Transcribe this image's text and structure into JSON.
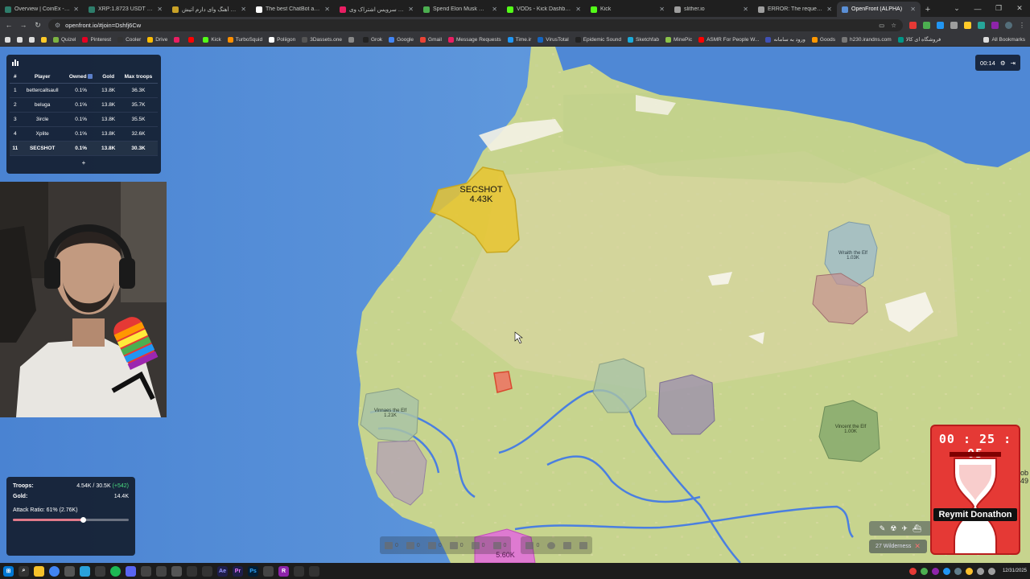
{
  "browser": {
    "tabs": [
      {
        "title": "Overview | CoinEx - The G",
        "color": "#2e7d6b",
        "active": false
      },
      {
        "title": "XRP:1.8723 USDT | Futur",
        "color": "#2e7d6b",
        "active": false
      },
      {
        "title": "دانلود آهنگ وای دارم آتیش",
        "color": "#c9a227",
        "active": false
      },
      {
        "title": "The best ChatBot and Wr",
        "color": "#ffffff",
        "active": false
      },
      {
        "title": "آپارات - سرویس اشتراک وی",
        "color": "#e91e63",
        "active": false
      },
      {
        "title": "Spend Elon Musk Money",
        "color": "#4caf50",
        "active": false
      },
      {
        "title": "VODs - Kick Dashboard",
        "color": "#53fc18",
        "active": false
      },
      {
        "title": "Kick",
        "color": "#53fc18",
        "active": false
      },
      {
        "title": "slither.io",
        "color": "#9e9e9e",
        "active": false
      },
      {
        "title": "ERROR: The request coul",
        "color": "#9e9e9e",
        "active": false
      },
      {
        "title": "OpenFront (ALPHA)",
        "color": "#5a8fd6",
        "active": true
      }
    ],
    "url": "openfront.io/#join=Dshfj6Cw",
    "bookmarks": [
      {
        "label": "Quizel",
        "color": "#7cb342"
      },
      {
        "label": "Pinterest",
        "color": "#e60023"
      },
      {
        "label": "Cooler",
        "color": "#333333"
      },
      {
        "label": "Drive",
        "color": "#fbbc04"
      },
      {
        "label": "",
        "color": "#e91e63"
      },
      {
        "label": "",
        "color": "#ff0000"
      },
      {
        "label": "Kick",
        "color": "#53fc18"
      },
      {
        "label": "TurboSquid",
        "color": "#ff8f00"
      },
      {
        "label": "Poliigon",
        "color": "#ffffff"
      },
      {
        "label": "3Dassets.one",
        "color": "#555555"
      },
      {
        "label": "",
        "color": "#888888"
      },
      {
        "label": "Grok",
        "color": "#222222"
      },
      {
        "label": "Google",
        "color": "#4285f4"
      },
      {
        "label": "Gmail",
        "color": "#ea4335"
      },
      {
        "label": "Message Requests",
        "color": "#e91e63"
      },
      {
        "label": "Time.ir",
        "color": "#2196f3"
      },
      {
        "label": "VirusTotal",
        "color": "#1565c0"
      },
      {
        "label": "Epidemic Sound",
        "color": "#222222"
      },
      {
        "label": "Sketchfab",
        "color": "#1caad9"
      },
      {
        "label": "MinePic",
        "color": "#8bc34a"
      },
      {
        "label": "ASMR For People W...",
        "color": "#ff0000"
      },
      {
        "label": "ورود به سامانه",
        "color": "#3f51b5"
      },
      {
        "label": "Goods",
        "color": "#ff9800"
      },
      {
        "label": "h230.irandns.com",
        "color": "#777777"
      },
      {
        "label": "فروشگاه ای کالا",
        "color": "#009688"
      }
    ],
    "all_bookmarks": "All Bookmarks"
  },
  "leaderboard": {
    "columns": [
      "#",
      "Player",
      "Owned",
      "Gold",
      "Max troops"
    ],
    "rows": [
      {
        "rank": "1",
        "player": "bettercallsaull",
        "owned": "0.1%",
        "gold": "13.8K",
        "troops": "36.3K"
      },
      {
        "rank": "2",
        "player": "beluga",
        "owned": "0.1%",
        "gold": "13.8K",
        "troops": "35.7K"
      },
      {
        "rank": "3",
        "player": "3ircle",
        "owned": "0.1%",
        "gold": "13.8K",
        "troops": "35.5K"
      },
      {
        "rank": "4",
        "player": "Xplite",
        "owned": "0.1%",
        "gold": "13.8K",
        "troops": "32.6K"
      },
      {
        "rank": "11",
        "player": "SECSHOT",
        "owned": "0.1%",
        "gold": "13.8K",
        "troops": "30.3K"
      }
    ],
    "more": "+"
  },
  "territories": {
    "secshot": {
      "name": "SECSHOT",
      "troops": "4.43K",
      "color": "#e8c430"
    },
    "wraith": {
      "name": "Wraith the Elf",
      "troops": "1.03K",
      "color": "#9fbcc8"
    },
    "vinnaes": {
      "name": "Vinnaes the Elf",
      "troops": "1.21K",
      "color": "#a9c3a6"
    },
    "vincent": {
      "name": "Vincent the Elf",
      "troops": "1.00K",
      "color": "#86a96d"
    },
    "bottom": {
      "name": "",
      "troops": "5.60K",
      "color": "#e070d8"
    }
  },
  "stats": {
    "troops_label": "Troops:",
    "troops_value": "4.54K / 30.5K",
    "troops_gain": "(+542)",
    "gold_label": "Gold:",
    "gold_value": "14.4K",
    "attack_ratio_label": "Attack Ratio: 61% (2.76K)",
    "attack_ratio": 0.61
  },
  "game_timer": "00:14",
  "build_bar": {
    "group1": [
      "0",
      "0",
      "0",
      "0",
      "0",
      "0"
    ],
    "group2": [
      "0"
    ]
  },
  "wilderness": "27 Wilderness",
  "stream_timer": "00 : 25 : 05",
  "donor": "Reymit Donathon",
  "edge_text": [
    "ob",
    "49"
  ],
  "clock": {
    "time": "",
    "date": "12/31/2025"
  }
}
